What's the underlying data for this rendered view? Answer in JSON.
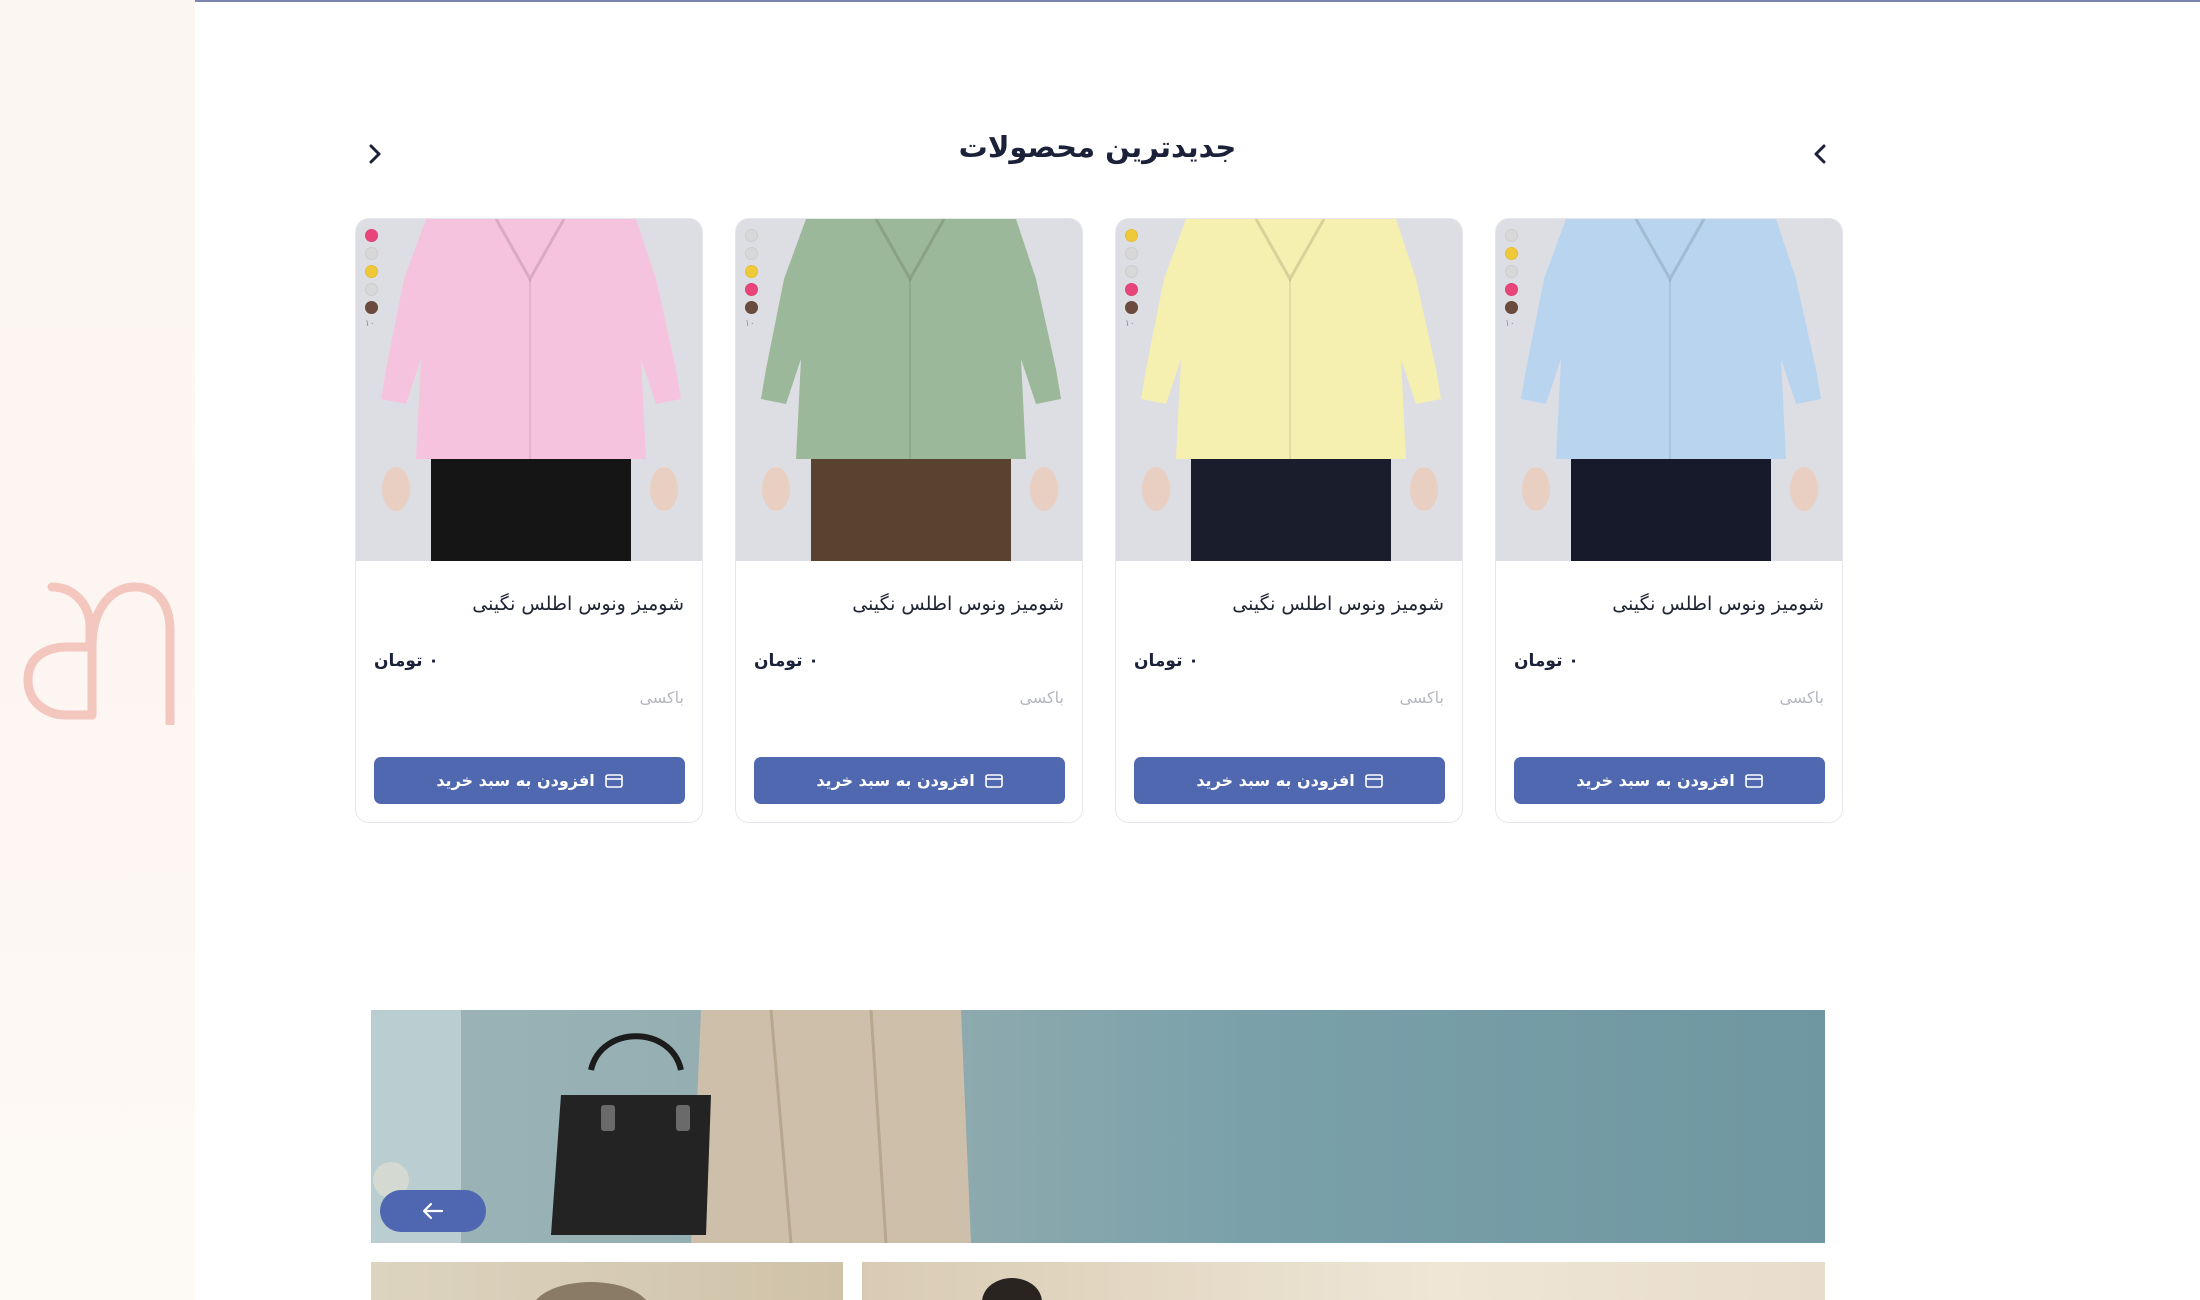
{
  "section": {
    "title": "جدیدترین محصولات"
  },
  "products": [
    {
      "title": "شومیز ونوس اطلس نگینی",
      "price": "۰ تومان",
      "brand": "باکسی",
      "cart_label": "افزودن به سبد خرید",
      "swatch_count": "۱۰",
      "swatches": [
        "#e8467a",
        "#d8d8d8",
        "#f0c93a",
        "#d8d8d8",
        "#6b4b3e"
      ],
      "shirt_color": "#f6c3de"
    },
    {
      "title": "شومیز ونوس اطلس نگینی",
      "price": "۰ تومان",
      "brand": "باکسی",
      "cart_label": "افزودن به سبد خرید",
      "swatch_count": "۱۰",
      "swatches": [
        "#d8d8d8",
        "#d8d8d8",
        "#f0c93a",
        "#e8467a",
        "#6b4b3e"
      ],
      "shirt_color": "#9cb89a"
    },
    {
      "title": "شومیز ونوس اطلس نگینی",
      "price": "۰ تومان",
      "brand": "باکسی",
      "cart_label": "افزودن به سبد خرید",
      "swatch_count": "۱۰",
      "swatches": [
        "#f0c93a",
        "#d8d8d8",
        "#d8d8d8",
        "#e8467a",
        "#6b4b3e"
      ],
      "shirt_color": "#f5efb0"
    },
    {
      "title": "شومیز ونوس اطلس نگینی",
      "price": "۰ تومان",
      "brand": "باکسی",
      "cart_label": "افزودن به سبد خرید",
      "swatch_count": "۱۰",
      "swatches": [
        "#d8d8d8",
        "#f0c93a",
        "#d8d8d8",
        "#e8467a",
        "#6b4b3e"
      ],
      "shirt_color": "#b9d4ef"
    }
  ],
  "colors": {
    "accent": "#5068b0",
    "title": "#1a2138",
    "logo": "#f3c7be"
  }
}
